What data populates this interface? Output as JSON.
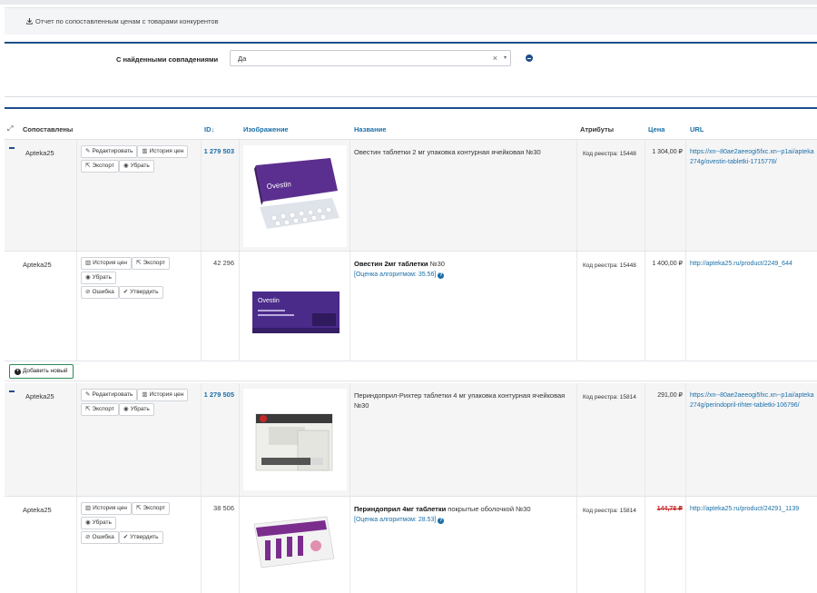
{
  "report": {
    "link_label": "Отчет по сопоставленным ценам с товарами конкурентов",
    "icon": "download-icon"
  },
  "filter": {
    "label": "С найденными совпадениями",
    "value": "Да",
    "clear": "×",
    "caret": "▾"
  },
  "table": {
    "headers": {
      "matched": "Сопоставлены",
      "id": "ID",
      "image": "Изображение",
      "name": "Название",
      "attrs": "Атрибуты",
      "price": "Цена",
      "url": "URL"
    },
    "add_new_label": "Добавить новый",
    "groups": [
      {
        "parent": {
          "store": "Apteka25",
          "buttons": [
            "Редактировать",
            "История цен",
            "Экспорт",
            "Убрать"
          ],
          "id": "1 279 503",
          "name": "Овестин таблетки 2 мг упаковка контурная ячейковая №30",
          "attr": "Код реестра: 15448",
          "price": "1 304,00 ₽",
          "url": "https://xn--80ae2aeeogi5fxc.xn--p1ai/apteka274g/ovestin-tabletki-1715778/"
        },
        "child": {
          "store": "Apteka25",
          "buttons": [
            "История цен",
            "Экспорт",
            "Убрать",
            "Ошибка",
            "Утвердить"
          ],
          "id": "42 296",
          "name_bold": "Овестин 2мг таблетки",
          "name_rest": " №30",
          "score": "[Оценка алгоритмом: 35.56]",
          "attr": "Код реестра: 15448",
          "price": "1 400,00 ₽",
          "url": "http://apteka25.ru/product/2249_644"
        }
      },
      {
        "parent": {
          "store": "Apteka25",
          "buttons": [
            "Редактировать",
            "История цен",
            "Экспорт",
            "Убрать"
          ],
          "id": "1 279 505",
          "name": "Периндоприл-Рихтер таблетки 4 мг упаковка контурная ячейковая №30",
          "attr": "Код реестра: 15814",
          "price": "291,00 ₽",
          "url": "https://xn--80ae2aeeogi5fxc.xn--p1ai/apteka274g/perindopril-rihter-tabletki-106796/"
        },
        "child": {
          "store": "Apteka25",
          "buttons": [
            "История цен",
            "Экспорт",
            "Убрать",
            "Ошибка",
            "Утвердить"
          ],
          "id": "38 506",
          "name_bold": "Периндоприл 4мг таблетки",
          "name_rest": " покрытые оболочкой №30",
          "score": "[Оценка алгоритмом: 28.53]",
          "attr": "Код реестра: 15814",
          "price": "144,78 ₽",
          "url": "http://apteka25.ru/product/24291_1139"
        }
      }
    ]
  },
  "colors": {
    "accent": "#1f4e8c",
    "link": "#1a6fa8",
    "danger": "#c62828",
    "group_bg": "#f5f5f6"
  }
}
